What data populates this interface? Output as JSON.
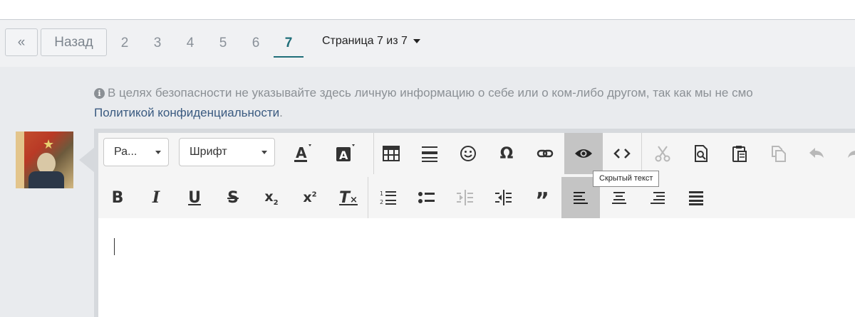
{
  "pagination": {
    "first_label": "«",
    "back_label": "Назад",
    "pages": [
      "2",
      "3",
      "4",
      "5",
      "6",
      "7"
    ],
    "current_page": "7",
    "page_select_label": "Страница 7 из 7"
  },
  "notice": {
    "text": "В целях безопасности не указывайте здесь личную информацию о себе или о ком-либо другом, так как мы не смо",
    "link_text": "Политикой конфиденциальности",
    "suffix": "."
  },
  "editor": {
    "format_select": "Ра...",
    "font_select": "Шрифт",
    "tooltip": "Скрытый текст",
    "buttons_row1": [
      "text-color",
      "background-color",
      "table",
      "horizontal-line",
      "smiley",
      "special-char",
      "link",
      "hidden-text",
      "source",
      "cut",
      "find",
      "paste",
      "copy",
      "undo",
      "redo"
    ],
    "buttons_row2": [
      "bold",
      "italic",
      "underline",
      "strikethrough",
      "subscript",
      "superscript",
      "remove-format",
      "numbered-list",
      "bulleted-list",
      "outdent",
      "indent",
      "blockquote",
      "align-left",
      "align-center",
      "align-right",
      "justify"
    ]
  },
  "colors": {
    "accent": "#1f6e79",
    "link": "#3a5a80",
    "toolbar_bg": "#f5f5f5",
    "active_button": "#c4c4c4"
  }
}
